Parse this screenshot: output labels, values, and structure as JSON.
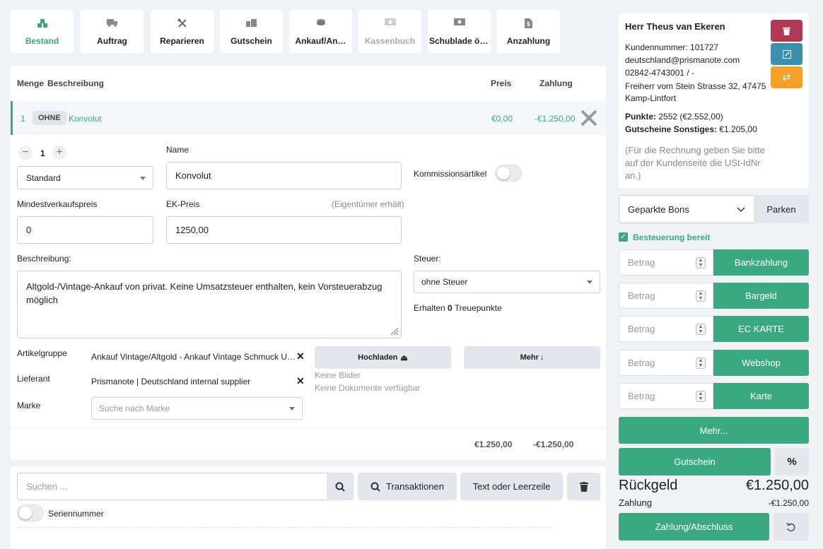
{
  "tabs": [
    {
      "label": "Bestand",
      "icon": "boxes-icon"
    },
    {
      "label": "Auftrag",
      "icon": "truck-icon"
    },
    {
      "label": "Reparieren",
      "icon": "tools-icon"
    },
    {
      "label": "Gutschein",
      "icon": "gift-icon"
    },
    {
      "label": "Ankauf/An…",
      "icon": "coins-icon"
    },
    {
      "label": "Kassenbuch",
      "icon": "cash-icon"
    },
    {
      "label": "Schublade öffnen",
      "icon": "drawer-icon"
    },
    {
      "label": "Anzahlung",
      "icon": "document-icon"
    }
  ],
  "table": {
    "headers": {
      "menge": "Menge",
      "beschreibung": "Beschreibung",
      "preis": "Preis",
      "zahlung": "Zahlung"
    },
    "row": {
      "qty": "1",
      "badge": "OHNE",
      "description": "Konvolut",
      "price": "€0,00",
      "payment": "-€1.250,00"
    }
  },
  "item": {
    "qty": "1",
    "price_type": "Standard",
    "name_label": "Name",
    "name_value": "Konvolut",
    "kommission_label": "Kommissionsartikel",
    "min_label": "Mindestverkaufspreis",
    "min_value": "0",
    "ek_label": "EK-Preis",
    "ek_hint": "(Eigentümer erhält)",
    "ek_value": "1250,00",
    "desc_label": "Beschreibung:",
    "desc_value": "Altgold-/Vintage-Ankauf von privat. Keine Umsatzsteuer enthalten, kein Vorsteuerabzug möglich",
    "tax_label": "Steuer:",
    "tax_value": "ohne Steuer",
    "points_pre": "Erhalten ",
    "points_value": "0",
    "points_post": " Treuepunkte",
    "group_label": "Artikelgruppe",
    "group_value": "Ankauf Vintage/Altgold - Ankauf Vintage Schmuck Uh…",
    "supplier_label": "Lieferant",
    "supplier_value": "Prismanote | Deutschland internal supplier",
    "brand_label": "Marke",
    "brand_placeholder": "Suche nach Marke",
    "upload_label": "Hochladen",
    "more_label": "Mehr",
    "no_images": "Keine Bilder",
    "no_docs": "Keine Dokumente verfügbar",
    "total_price": "€1.250,00",
    "total_payment": "-€1.250,00"
  },
  "search": {
    "placeholder": "Suchen ...",
    "transactions": "Transaktionen",
    "text_line": "Text oder Leerzeile",
    "serial": "Seriennummer"
  },
  "customer": {
    "name": "Herr Theus van Ekeren",
    "number": "Kundennummer: 101727",
    "email": "deutschland@prismanote.com",
    "phone": "02842-4743001 / -",
    "address": "Freiherr vom Stein Strasse 32, 47475 Kamp-Lintfort",
    "points_label": "Punkte:",
    "points_value": " 2552 (€2.552,00)",
    "vouchers_label": "Gutscheine Sonstiges:",
    "vouchers_value": " €1.205,00",
    "note": "(Für die Rechnung geben Sie bitte auf der Kundenseite die USt-IdNr an.)"
  },
  "parked": {
    "select": "Geparkte Bons",
    "button": "Parken"
  },
  "tax_ready": "Besteuerung bereit",
  "payments": [
    {
      "placeholder": "Betrag",
      "label": "Bankzahlung"
    },
    {
      "placeholder": "Betrag",
      "label": "Bargeld"
    },
    {
      "placeholder": "Betrag",
      "label": "EC KARTE"
    },
    {
      "placeholder": "Betrag",
      "label": "Webshop"
    },
    {
      "placeholder": "Betrag",
      "label": "Karte"
    }
  ],
  "more_payments": "Mehr...",
  "voucher_button": "Gutschein",
  "percent": "%",
  "change_label": "Rückgeld",
  "change_value": "€1.250,00",
  "payment_label": "Zahlung",
  "payment_value": "-€1.250,00",
  "checkout": "Zahlung/Abschluss",
  "colors": {
    "accent": "#3aa981",
    "danger": "#b03a55",
    "info": "#3d8fb0",
    "warning": "#f5a02a"
  }
}
